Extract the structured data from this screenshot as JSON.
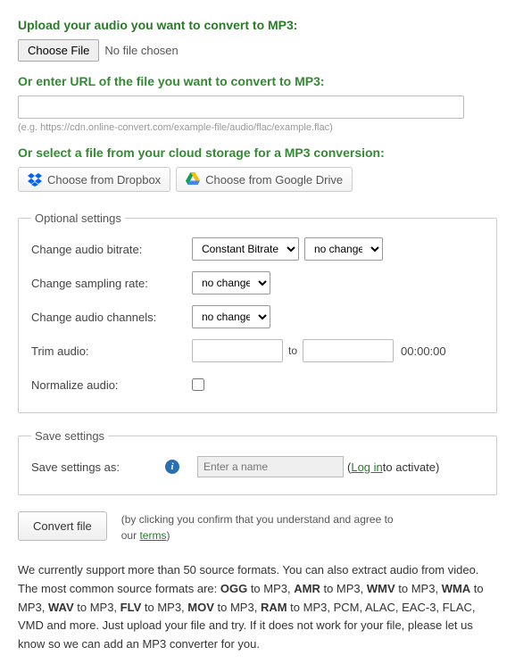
{
  "upload": {
    "heading": "Upload your audio you want to convert to MP3:",
    "choose_btn": "Choose File",
    "no_file": "No file chosen"
  },
  "url": {
    "heading": "Or enter URL of the file you want to convert to MP3:",
    "value": "",
    "example": "(e.g. https://cdn.online-convert.com/example-file/audio/flac/example.flac)"
  },
  "cloud": {
    "heading": "Or select a file from your cloud storage for a MP3 conversion:",
    "dropbox": "Choose from Dropbox",
    "gdrive": "Choose from Google Drive"
  },
  "optional": {
    "legend": "Optional settings",
    "bitrate_label": "Change audio bitrate:",
    "bitrate_type": "Constant Bitrate",
    "bitrate_value": "no change",
    "sampling_label": "Change sampling rate:",
    "sampling_value": "no change",
    "channels_label": "Change audio channels:",
    "channels_value": "no change",
    "trim_label": "Trim audio:",
    "trim_to": "to",
    "trim_dur": "00:00:00",
    "normalize_label": "Normalize audio:"
  },
  "save": {
    "legend": "Save settings",
    "label": "Save settings as:",
    "placeholder": "Enter a name",
    "login": "Log in",
    "activate": " to activate)"
  },
  "convert": {
    "button": "Convert file",
    "disclaimer_a": "(by clicking you confirm that you understand and agree to our ",
    "terms": "terms",
    "disclaimer_b": ")"
  },
  "support": {
    "a": "We currently support more than 50 source formats. You can also extract audio from video. The most common source formats are: ",
    "ogg": "OGG",
    "t1": " to MP3, ",
    "amr": "AMR",
    "t2": " to MP3, ",
    "wmv": "WMV",
    "t3": " to MP3, ",
    "wma": "WMA",
    "t4": " to MP3, ",
    "wav": "WAV",
    "t5": " to MP3, ",
    "flv": "FLV",
    "t6": " to MP3, ",
    "mov": "MOV",
    "t7": " to MP3, ",
    "ram": "RAM",
    "b": " to MP3, PCM, ALAC, EAC-3, FLAC, VMD and more. Just upload your file and try. If it does not work for your file, please let us know so we can add an MP3 converter for you."
  }
}
